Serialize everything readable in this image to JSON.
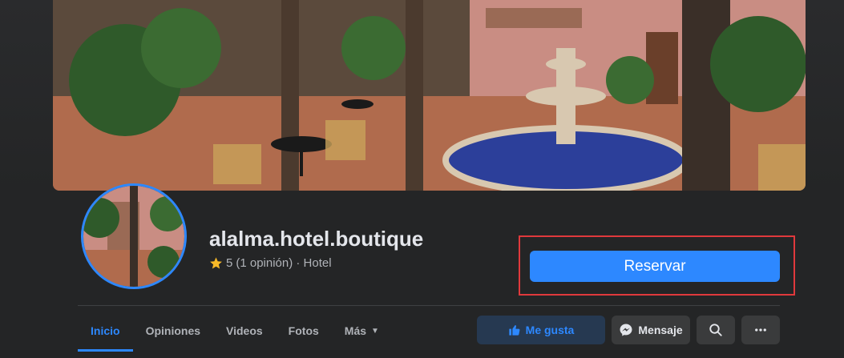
{
  "page": {
    "name": "alalma.hotel.boutique",
    "rating_value": "5",
    "rating_text": "(1 opinión) · Hotel"
  },
  "actions": {
    "reserve_label": "Reservar",
    "like_label": "Me gusta",
    "message_label": "Mensaje"
  },
  "tabs": [
    {
      "label": "Inicio",
      "active": true
    },
    {
      "label": "Opiniones"
    },
    {
      "label": "Videos"
    },
    {
      "label": "Fotos"
    },
    {
      "label": "Más"
    }
  ],
  "colors": {
    "accent": "#2d88ff",
    "highlight": "#e0393c",
    "background": "#242526"
  },
  "icons": {
    "star": "star-icon",
    "like": "thumbs-up-icon",
    "message": "messenger-icon",
    "search": "search-icon",
    "more": "more-dots-icon",
    "caret": "caret-down-icon"
  }
}
